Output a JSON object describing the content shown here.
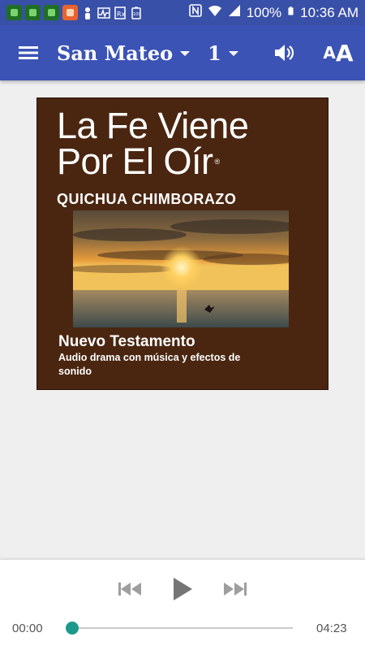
{
  "status_bar": {
    "battery": "100%",
    "time": "10:36 AM",
    "icons": [
      "app-notification-icon",
      "app-notification-icon",
      "app-notification-icon",
      "app-notification-icon",
      "person-icon",
      "activity-icon",
      "prescription-icon",
      "battery-100-icon",
      "nfc-icon",
      "wifi-icon",
      "signal-icon"
    ]
  },
  "app_bar": {
    "book": "San Mateo",
    "chapter": "1",
    "text_size_small": "A",
    "text_size_big": "A",
    "color": "#3b53b4"
  },
  "cover": {
    "title_line1": "La Fe Viene",
    "title_line2": "Por El Oír",
    "registered": "®",
    "language": "QUICHUA CHIMBORAZO",
    "subtitle": "Nuevo Testamento",
    "description": "Audio drama con música y efectos de sonido",
    "background": "#4a2611"
  },
  "player": {
    "elapsed": "00:00",
    "total": "04:23",
    "progress": 0,
    "accent": "#26a69a"
  }
}
